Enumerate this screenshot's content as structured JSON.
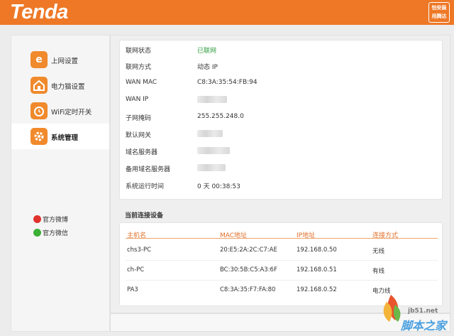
{
  "header": {
    "logo_text": "Tenda",
    "badge_line1": "怕安装",
    "badge_line2": "用腾达"
  },
  "sidebar": {
    "items": [
      {
        "label": "上网设置",
        "icon": "internet-e-icon"
      },
      {
        "label": "电力猫设置",
        "icon": "powerline-house-icon"
      },
      {
        "label": "WiFi定时开关",
        "icon": "wifi-timer-icon"
      },
      {
        "label": "系统管理",
        "icon": "system-gear-icon",
        "active": true
      }
    ],
    "social": [
      {
        "label": "官方微博",
        "icon": "weibo-icon"
      },
      {
        "label": "官方微信",
        "icon": "wechat-icon"
      }
    ]
  },
  "status": {
    "rows": [
      {
        "label": "联网状态",
        "value": "已联网"
      },
      {
        "label": "联网方式",
        "value": "动态 IP"
      },
      {
        "label": "WAN MAC",
        "value": "C8:3A:35:54:FB:94"
      },
      {
        "label": "WAN IP",
        "value": ""
      },
      {
        "label": "子网掩码",
        "value": "255.255.248.0"
      },
      {
        "label": "默认网关",
        "value": ""
      },
      {
        "label": "域名服务器",
        "value": ""
      },
      {
        "label": "备用域名服务器",
        "value": ""
      },
      {
        "label": "系统运行时间",
        "value": "0 天 00:38:53"
      }
    ]
  },
  "devices": {
    "title": "当前连接设备",
    "columns": [
      "主机名",
      "MAC地址",
      "IP地址",
      "连接方式"
    ],
    "rows": [
      {
        "host": "chs3-PC",
        "mac": "20:E5:2A:2C:C7:AE",
        "ip": "192.168.0.50",
        "type": "无线"
      },
      {
        "host": "ch-PC",
        "mac": "BC:30:5B:C5:A3:6F",
        "ip": "192.168.0.51",
        "type": "有线"
      },
      {
        "host": "PA3",
        "mac": "C8:3A:35:F7:FA:80",
        "ip": "192.168.0.52",
        "type": "电力线"
      }
    ]
  },
  "watermark": {
    "url": "jb51.net",
    "text": "脚本之家"
  },
  "colors": {
    "brand": "#ee7826",
    "connected": "#2e9e3c",
    "table_header": "#e2702a"
  }
}
